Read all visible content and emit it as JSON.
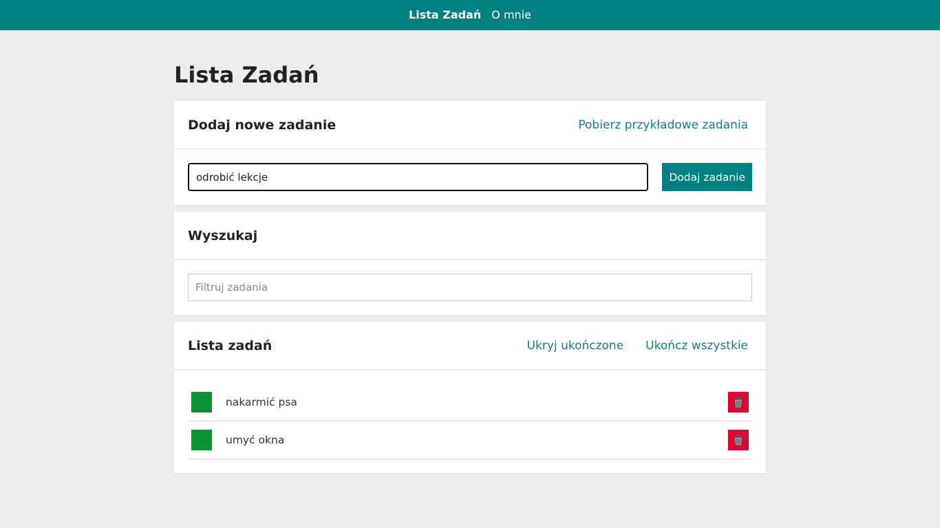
{
  "nav": {
    "items": [
      {
        "label": "Lista Zadań",
        "active": true
      },
      {
        "label": "O mnie",
        "active": false
      }
    ]
  },
  "page": {
    "title": "Lista Zadań"
  },
  "add_card": {
    "title": "Dodaj nowe zadanie",
    "sample_link": "Pobierz przykładowe zadania",
    "input_value": "odrobić lekcje",
    "button_label": "Dodaj zadanie"
  },
  "search_card": {
    "title": "Wyszukaj",
    "placeholder": "Filtruj zadania"
  },
  "list_card": {
    "title": "Lista zadań",
    "hide_done_link": "Ukryj ukończone",
    "complete_all_link": "Ukończ wszystkie",
    "tasks": [
      {
        "text": "nakarmić psa",
        "done": false
      },
      {
        "text": "umyć okna",
        "done": false
      }
    ]
  },
  "colors": {
    "nav_bg": "#008080",
    "accent": "#008080",
    "done_toggle": "#089435",
    "delete": "#e5002e",
    "page_bg": "#ededed"
  },
  "icons": {
    "delete": "trash-icon"
  }
}
